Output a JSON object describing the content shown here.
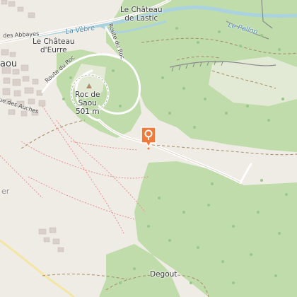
{
  "map": {
    "labels": {
      "chateau_lastic_1": "Le Château",
      "chateau_lastic_2": "de Lastic",
      "chateau_eurre_1": "Le Château",
      "chateau_eurre_2": "d'Eurre",
      "rue_abbayes": "des Abbayes",
      "rue_auches": "ue des Auches",
      "route_du_roc_1": "Route du Roc",
      "route_du_roc_2": "Route du Roc",
      "la_vebre": "La Vèbre",
      "le_pellon": "Le Pellon",
      "roc_de_saou_1": "Roc de",
      "roc_de_saou_2": "Saou",
      "roc_elevation": "501 m",
      "saou_partial": "aou",
      "er_partial": "er",
      "degout": "Degout"
    },
    "marker": {
      "icon": "location-pin-icon",
      "color": "#f07a3a"
    },
    "colors": {
      "forest": "#bfdcaa",
      "forest_dark": "#add39a",
      "land": "#efece5",
      "water": "#aad3df",
      "road": "#ffffff",
      "path": "#e88f8f",
      "track": "#a68b62"
    }
  }
}
